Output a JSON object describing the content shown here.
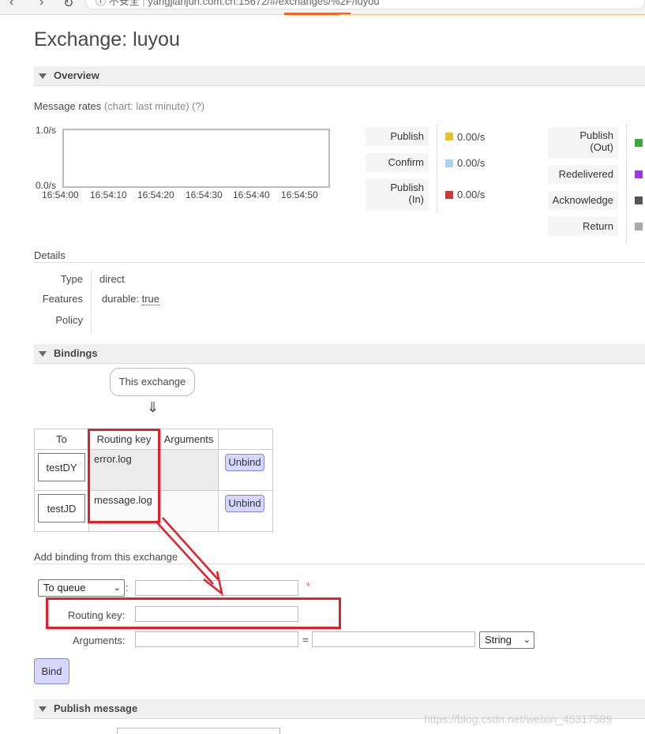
{
  "browser": {
    "security_label": "不安全",
    "url": "yangjianjun.com.cn:15672/#/exchanges/%2F/luyou"
  },
  "page": {
    "title": "Exchange: luyou"
  },
  "overview": {
    "heading": "Overview",
    "message_rates_label": "Message rates",
    "chart_hint": "(chart: last minute)",
    "help": "(?)",
    "chart": {
      "y_top": "1.0/s",
      "y_bottom": "0.0/s",
      "x_ticks": [
        "16:54:00",
        "16:54:10",
        "16:54:20",
        "16:54:30",
        "16:54:40",
        "16:54:50"
      ]
    },
    "rates_in": [
      {
        "label": "Publish",
        "value": "0.00/s",
        "color": "#e8c02c"
      },
      {
        "label": "Confirm",
        "value": "0.00/s",
        "color": "#a8d4f0"
      },
      {
        "label_line1": "Publish",
        "label_line2": "(In)",
        "value": "0.00/s",
        "color": "#c93b3b"
      }
    ],
    "rates_out": [
      {
        "label_line1": "Publish",
        "label_line2": "(Out)",
        "color": "#3aaa3a"
      },
      {
        "label": "Redelivered",
        "color": "#9a3ae0"
      },
      {
        "label": "Acknowledge",
        "color": "#555555"
      },
      {
        "label": "Return",
        "color": "#aaaaaa"
      }
    ]
  },
  "details": {
    "heading": "Details",
    "type_key": "Type",
    "type_value": "direct",
    "features_key": "Features",
    "durable_key": "durable:",
    "durable_value": "true",
    "policy_key": "Policy"
  },
  "bindings": {
    "heading": "Bindings",
    "this_exchange": "This exchange",
    "arrow": "⇓",
    "columns": [
      "To",
      "Routing key",
      "Arguments",
      ""
    ],
    "rows": [
      {
        "to": "testDY",
        "routing_key": "error.log",
        "arguments": "",
        "action": "Unbind"
      },
      {
        "to": "testJD",
        "routing_key": "message.log",
        "arguments": "",
        "action": "Unbind"
      }
    ]
  },
  "add_binding": {
    "heading": "Add binding from this exchange",
    "destination_select": "To queue",
    "colon": ":",
    "required_mark": "*",
    "routing_key_label": "Routing key:",
    "arguments_label": "Arguments:",
    "equals": "=",
    "type_select": "String",
    "bind_button": "Bind"
  },
  "publish": {
    "heading": "Publish message"
  },
  "watermark": "https://blog.csdn.net/weixin_45317589"
}
